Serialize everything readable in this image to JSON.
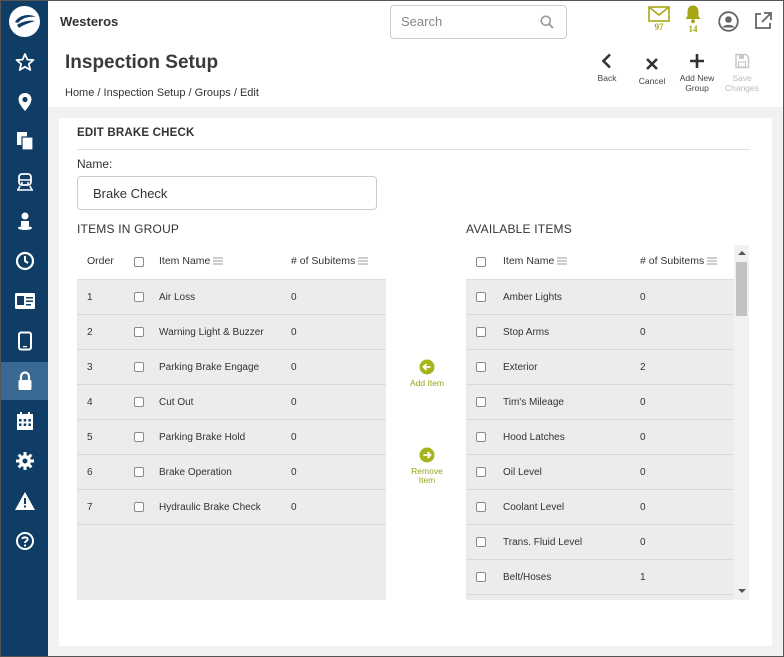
{
  "app": {
    "title": "Westeros"
  },
  "search": {
    "placeholder": "Search"
  },
  "notifications": {
    "mail_count": "97",
    "alert_count": "14"
  },
  "page": {
    "title": "Inspection Setup",
    "breadcrumb": [
      "Home",
      "Inspection Setup",
      "Groups",
      "Edit"
    ],
    "breadcrumb_sep": "/"
  },
  "actions": {
    "back": "Back",
    "cancel": "Cancel",
    "add_new_group": "Add New Group",
    "save_changes": "Save Changes"
  },
  "form": {
    "section_title": "EDIT BRAKE CHECK",
    "name_label": "Name:",
    "name_value": "Brake Check"
  },
  "group_items": {
    "title": "ITEMS IN GROUP",
    "columns": {
      "order": "Order",
      "item_name": "Item Name",
      "subitems": "# of Subitems"
    },
    "rows": [
      {
        "order": "1",
        "name": "Air Loss",
        "subitems": "0"
      },
      {
        "order": "2",
        "name": "Warning Light & Buzzer",
        "subitems": "0"
      },
      {
        "order": "3",
        "name": "Parking Brake Engage",
        "subitems": "0"
      },
      {
        "order": "4",
        "name": "Cut Out",
        "subitems": "0"
      },
      {
        "order": "5",
        "name": "Parking Brake Hold",
        "subitems": "0"
      },
      {
        "order": "6",
        "name": "Brake Operation",
        "subitems": "0"
      },
      {
        "order": "7",
        "name": "Hydraulic Brake Check",
        "subitems": "0"
      }
    ]
  },
  "transfer": {
    "add_item": "Add Item",
    "remove_item": "Remove Item"
  },
  "available_items": {
    "title": "AVAILABLE ITEMS",
    "columns": {
      "item_name": "Item Name",
      "subitems": "# of Subitems"
    },
    "rows": [
      {
        "name": "Amber Lights",
        "subitems": "0"
      },
      {
        "name": "Stop Arms",
        "subitems": "0"
      },
      {
        "name": "Exterior",
        "subitems": "2"
      },
      {
        "name": "Tim's Mileage",
        "subitems": "0"
      },
      {
        "name": "Hood Latches",
        "subitems": "0"
      },
      {
        "name": "Oil Level",
        "subitems": "0"
      },
      {
        "name": "Coolant Level",
        "subitems": "0"
      },
      {
        "name": "Trans. Fluid Level",
        "subitems": "0"
      },
      {
        "name": "Belt/Hoses",
        "subitems": "1"
      }
    ]
  },
  "sidebar": {
    "items": [
      "star-icon",
      "map-pin-icon",
      "documents-icon",
      "bus-icon",
      "driver-icon",
      "clock-icon",
      "id-card-icon",
      "tablet-icon",
      "lock-icon",
      "calendar-icon",
      "gear-icon",
      "warning-icon",
      "help-icon"
    ],
    "active": "lock-icon"
  },
  "colors": {
    "sidebar": "#0f3d66",
    "sidebar_active": "#3a6a94",
    "accent": "#a7a614",
    "text": "#333333"
  }
}
